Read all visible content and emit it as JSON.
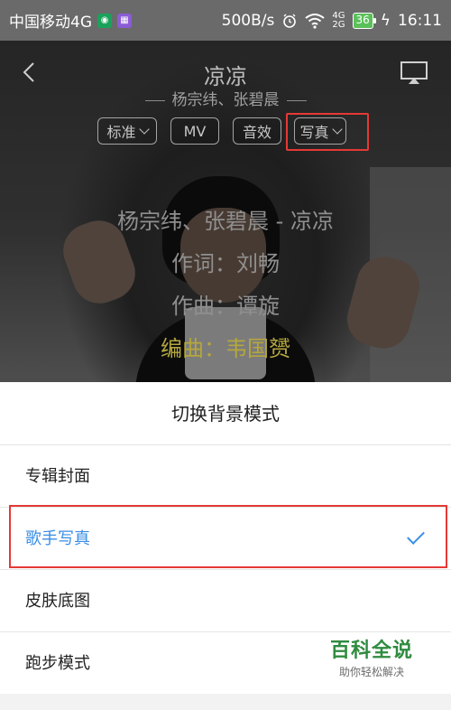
{
  "status_bar": {
    "carrier": "中国移动4G",
    "speed": "500B/s",
    "net_top": "4G",
    "net_bottom": "2G",
    "battery": "36",
    "time": "16:11"
  },
  "player": {
    "title": "凉凉",
    "artists": "杨宗纬、张碧晨",
    "buttons": {
      "quality": "标准",
      "mv": "MV",
      "effect": "音效",
      "photo": "写真"
    },
    "lyrics": [
      "杨宗纬、张碧晨 - 凉凉",
      "作词：刘畅",
      "作曲：谭旋",
      "编曲：韦国赟"
    ]
  },
  "sheet": {
    "title": "切换背景模式",
    "options": [
      {
        "label": "专辑封面",
        "selected": false
      },
      {
        "label": "歌手写真",
        "selected": true
      },
      {
        "label": "皮肤底图",
        "selected": false
      },
      {
        "label": "跑步模式",
        "selected": false
      }
    ]
  },
  "watermark": {
    "main": "百科全说",
    "sub": "助你轻松解决"
  },
  "colors": {
    "accent": "#3a8ee6",
    "highlight_box": "#e53935",
    "lyric_highlight": "#b4a73e"
  }
}
